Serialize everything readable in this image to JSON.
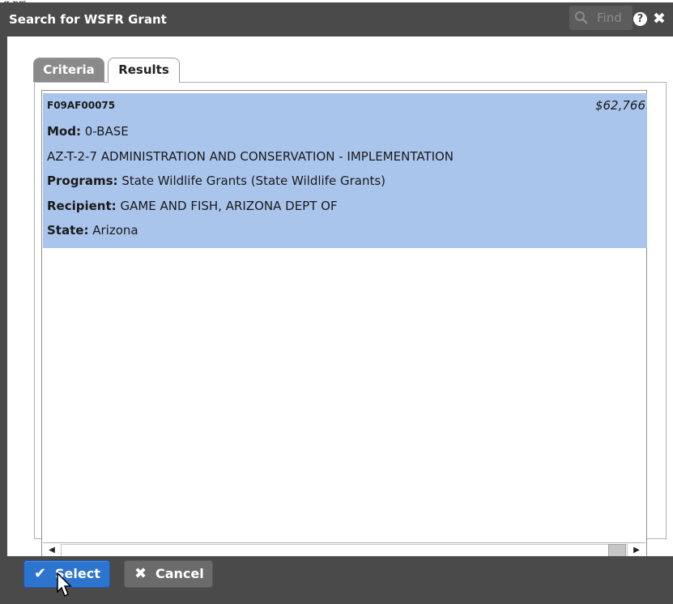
{
  "background": {
    "peek_text": "g pri"
  },
  "dialog": {
    "title": "Search for WSFR Grant",
    "find_label": "Find",
    "help_glyph": "?",
    "close_glyph": "✖"
  },
  "tabs": [
    {
      "label": "Criteria",
      "active": false
    },
    {
      "label": "Results",
      "active": true
    }
  ],
  "results": [
    {
      "grant_id": "F09AF00075",
      "amount": "$62,766",
      "mod_label": "Mod:",
      "mod_value": "0-BASE",
      "description": "AZ-T-2-7 ADMINISTRATION AND CONSERVATION - IMPLEMENTATION",
      "programs_label": "Programs:",
      "programs_value": "State Wildlife Grants (State Wildlife Grants)",
      "recipient_label": "Recipient:",
      "recipient_value": "GAME AND FISH, ARIZONA DEPT OF",
      "state_label": "State:",
      "state_value": "Arizona",
      "selected": true
    }
  ],
  "footer": {
    "select_label": "Select",
    "select_icon": "check-icon",
    "cancel_label": "Cancel",
    "cancel_icon": "x-icon"
  },
  "colors": {
    "selection": "#aac5ec",
    "chrome": "#4a4a4a",
    "primary": "#2c74cd"
  }
}
